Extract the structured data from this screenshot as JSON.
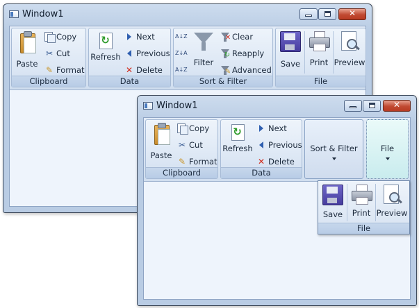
{
  "window1": {
    "title": "Window1",
    "groups": {
      "clipboard": {
        "label": "Clipboard",
        "paste": "Paste",
        "copy": "Copy",
        "cut": "Cut",
        "format": "Format"
      },
      "data": {
        "label": "Data",
        "refresh": "Refresh",
        "next": "Next",
        "previous": "Previous",
        "delete": "Delete"
      },
      "sort": {
        "label": "Sort & Filter",
        "filter": "Filter",
        "clear": "Clear",
        "reapply": "Reapply",
        "advanced": "Advanced",
        "sort_az": "A↓Z",
        "sort_za": "Z↓A",
        "sort_custom": "A↓Z"
      },
      "file": {
        "label": "File",
        "save": "Save",
        "print": "Print",
        "preview": "Preview"
      }
    }
  },
  "window2": {
    "title": "Window1",
    "groups": {
      "clipboard": {
        "label": "Clipboard",
        "paste": "Paste",
        "copy": "Copy",
        "cut": "Cut",
        "format": "Format"
      },
      "data": {
        "label": "Data",
        "refresh": "Refresh",
        "next": "Next",
        "previous": "Previous",
        "delete": "Delete"
      },
      "sort_collapsed": {
        "label": "Sort & Filter"
      },
      "file_collapsed": {
        "label": "File"
      },
      "file_popup": {
        "label": "File",
        "save": "Save",
        "print": "Print",
        "preview": "Preview"
      }
    }
  },
  "icons": {
    "paste": "clipboard-icon",
    "copy": "copy-icon",
    "cut": "scissors-icon",
    "format": "format-painter-icon",
    "refresh": "refresh-icon",
    "next": "arrow-right-icon",
    "previous": "arrow-left-icon",
    "delete": "delete-icon",
    "filter": "funnel-icon",
    "save": "floppy-disk-icon",
    "print": "printer-icon",
    "preview": "magnifier-icon"
  },
  "colors": {
    "ribbon": "#d6e3f3",
    "group_label": "#bfd2ea",
    "client": "#eef4fc",
    "close_button": "#c14a32"
  }
}
